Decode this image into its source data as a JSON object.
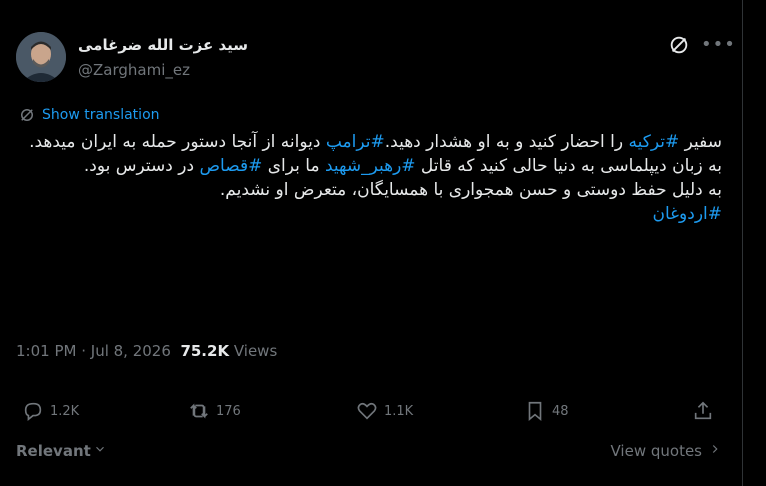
{
  "author": {
    "display_name": "سید عزت الله ضرغامی",
    "handle": "@Zarghami_ez"
  },
  "header_icons": [
    "grok-icon",
    "more-icon"
  ],
  "translate": {
    "label": "Show translation"
  },
  "tweet": {
    "p1": {
      "s1": "سفیر ",
      "h1": "#ترکیه",
      "s2": " را احضار کنید و به او هشدار دهید.",
      "h2": "#ترامپ",
      "s3": " دیوانه از آنجا دستور حمله به ایران میدهد."
    },
    "p2": {
      "s1": "به زبان دیپلماسی به دنیا حالی کنید که قاتل  ",
      "h1": "#رهبر_شهید",
      "s2": " ما برای ",
      "h2": "#قصاص",
      "s3": " در دسترس بود."
    },
    "p3": "به دلیل حفظ دوستی و حسن همجواری با همسایگان، متعرض او نشدیم.",
    "p4": "#اردوغان"
  },
  "meta": {
    "time": "1:01 PM",
    "sep": " · ",
    "date": "Jul 8, 2026",
    "views_count": "75.2K",
    "views_label": " Views"
  },
  "actions": {
    "replies": "1.2K",
    "reposts": "176",
    "likes": "1.1K",
    "bookmarks": "48"
  },
  "bottom": {
    "sort_label": "Relevant",
    "view_quotes_label": "View quotes"
  },
  "colors": {
    "accent": "#1d9bf0",
    "muted": "#71767b",
    "text": "#e7e9ea",
    "bg": "#000000"
  }
}
